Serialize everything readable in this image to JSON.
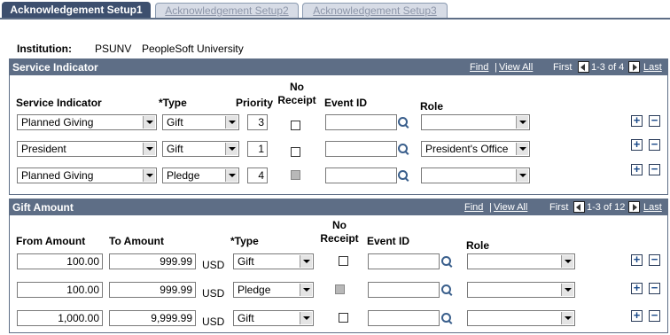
{
  "tabs": [
    {
      "label": "Acknowledgement Setup1",
      "active": true
    },
    {
      "label": "Acknowledgement Setup2",
      "active": false
    },
    {
      "label": "Acknowledgement Setup3",
      "active": false
    }
  ],
  "institution": {
    "label": "Institution:",
    "code": "PSUNV",
    "description": "PeopleSoft University"
  },
  "service_indicator": {
    "title": "Service Indicator",
    "nav": {
      "find": "Find",
      "sep": "|",
      "view_all": "View All",
      "first": "First",
      "range": "1-3 of 4",
      "last": "Last"
    },
    "columns": {
      "service_indicator": "Service Indicator",
      "type": "*Type",
      "priority": "Priority",
      "no_receipt_1": "No",
      "no_receipt_2": "Receipt",
      "event_id": "Event ID",
      "role": "Role"
    },
    "rows": [
      {
        "service_indicator": "Planned Giving",
        "type": "Gift",
        "priority": "3",
        "no_receipt": false,
        "no_receipt_disabled": false,
        "event_id": "",
        "role": ""
      },
      {
        "service_indicator": "President",
        "type": "Gift",
        "priority": "1",
        "no_receipt": false,
        "no_receipt_disabled": false,
        "event_id": "",
        "role": "President's Office"
      },
      {
        "service_indicator": "Planned Giving",
        "type": "Pledge",
        "priority": "4",
        "no_receipt": false,
        "no_receipt_disabled": true,
        "event_id": "",
        "role": ""
      }
    ]
  },
  "gift_amount": {
    "title": "Gift Amount",
    "nav": {
      "find": "Find",
      "sep": "|",
      "view_all": "View All",
      "first": "First",
      "range": "1-3 of 12",
      "last": "Last"
    },
    "columns": {
      "from_amount": "From Amount",
      "to_amount": "To Amount",
      "type": "*Type",
      "no_receipt_1": "No",
      "no_receipt_2": "Receipt",
      "event_id": "Event ID",
      "role": "Role"
    },
    "rows": [
      {
        "from_amount": "100.00",
        "to_amount": "999.99",
        "currency": "USD",
        "type": "Gift",
        "no_receipt": false,
        "no_receipt_disabled": false,
        "event_id": "",
        "role": ""
      },
      {
        "from_amount": "100.00",
        "to_amount": "999.99",
        "currency": "USD",
        "type": "Pledge",
        "no_receipt": false,
        "no_receipt_disabled": true,
        "event_id": "",
        "role": ""
      },
      {
        "from_amount": "1,000.00",
        "to_amount": "9,999.99",
        "currency": "USD",
        "type": "Gift",
        "no_receipt": false,
        "no_receipt_disabled": false,
        "event_id": "",
        "role": ""
      }
    ]
  },
  "row_buttons": {
    "add": "+",
    "delete": "−"
  }
}
